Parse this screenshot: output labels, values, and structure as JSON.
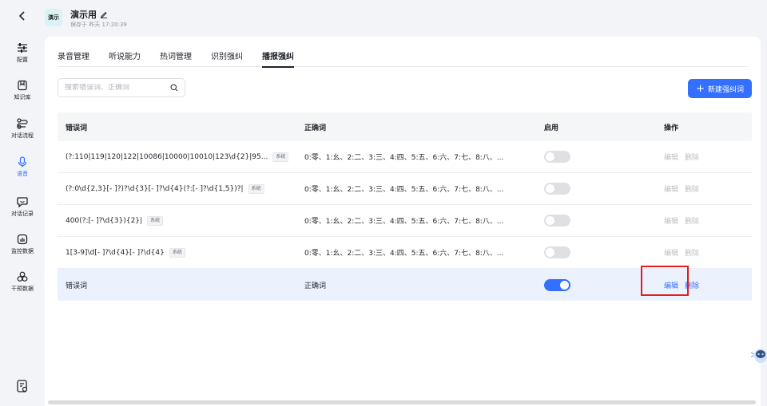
{
  "header": {
    "badge": "演示",
    "title": "演示用",
    "saved_at": "保存于 昨天 17:20:39"
  },
  "sidebar": {
    "items": [
      {
        "label": "配置",
        "icon": "sliders-icon"
      },
      {
        "label": "知识库",
        "icon": "bookmark-icon"
      },
      {
        "label": "对话流程",
        "icon": "flow-icon"
      },
      {
        "label": "语音",
        "icon": "microphone-icon"
      },
      {
        "label": "对话记录",
        "icon": "chat-icon"
      },
      {
        "label": "监控数据",
        "icon": "bar-chart-icon"
      },
      {
        "label": "干预数据",
        "icon": "circles-icon"
      }
    ],
    "active_index": 3
  },
  "tabs": [
    {
      "label": "录音管理"
    },
    {
      "label": "听说能力"
    },
    {
      "label": "热词管理"
    },
    {
      "label": "识别强纠"
    },
    {
      "label": "播报强纠"
    }
  ],
  "active_tab": 4,
  "search": {
    "placeholder": "搜索错误词、正确词"
  },
  "new_button": {
    "label": "新建强纠词"
  },
  "table": {
    "columns": [
      "错误词",
      "正确词",
      "启用",
      "操作"
    ],
    "rows": [
      {
        "wrong": "(?:110|119|120|122|10086|10000|10010|123\\d{2}|95...",
        "tag": "系统",
        "correct": "0:零、1:幺、2:二、3:三、4:四、5:五、6:六、7:七、8:八、...",
        "enabled": false,
        "edit": "编辑",
        "delete": "删除"
      },
      {
        "wrong": "(?:0\\d{2,3}[- ]?)?\\d{3}[- ]?\\d{4}(?:[- ]?\\d{1,5})?|",
        "tag": "系统",
        "correct": "0:零、1:幺、2:二、3:三、4:四、5:五、6:六、7:七、8:八、...",
        "enabled": false,
        "edit": "编辑",
        "delete": "删除"
      },
      {
        "wrong": "400(?:[- ]?\\d{3}){2}|",
        "tag": "系统",
        "correct": "0:零、1:幺、2:二、3:三、4:四、5:五、6:六、7:七、8:八、...",
        "enabled": false,
        "edit": "编辑",
        "delete": "删除"
      },
      {
        "wrong": "1[3-9]\\d[- ]?\\d{4}[- ]?\\d{4}",
        "tag": "系统",
        "correct": "0:零、1:幺、2:二、3:三、4:四、5:五、6:六、7:七、8:八、...",
        "enabled": false,
        "edit": "编辑",
        "delete": "删除"
      },
      {
        "wrong": "错误词",
        "tag": "",
        "correct": "正确词",
        "enabled": true,
        "edit": "编辑",
        "delete": "删除"
      }
    ]
  },
  "colors": {
    "accent": "#3370ff",
    "highlight_row": "#ecf1fe",
    "annotation": "#e21d1d"
  }
}
